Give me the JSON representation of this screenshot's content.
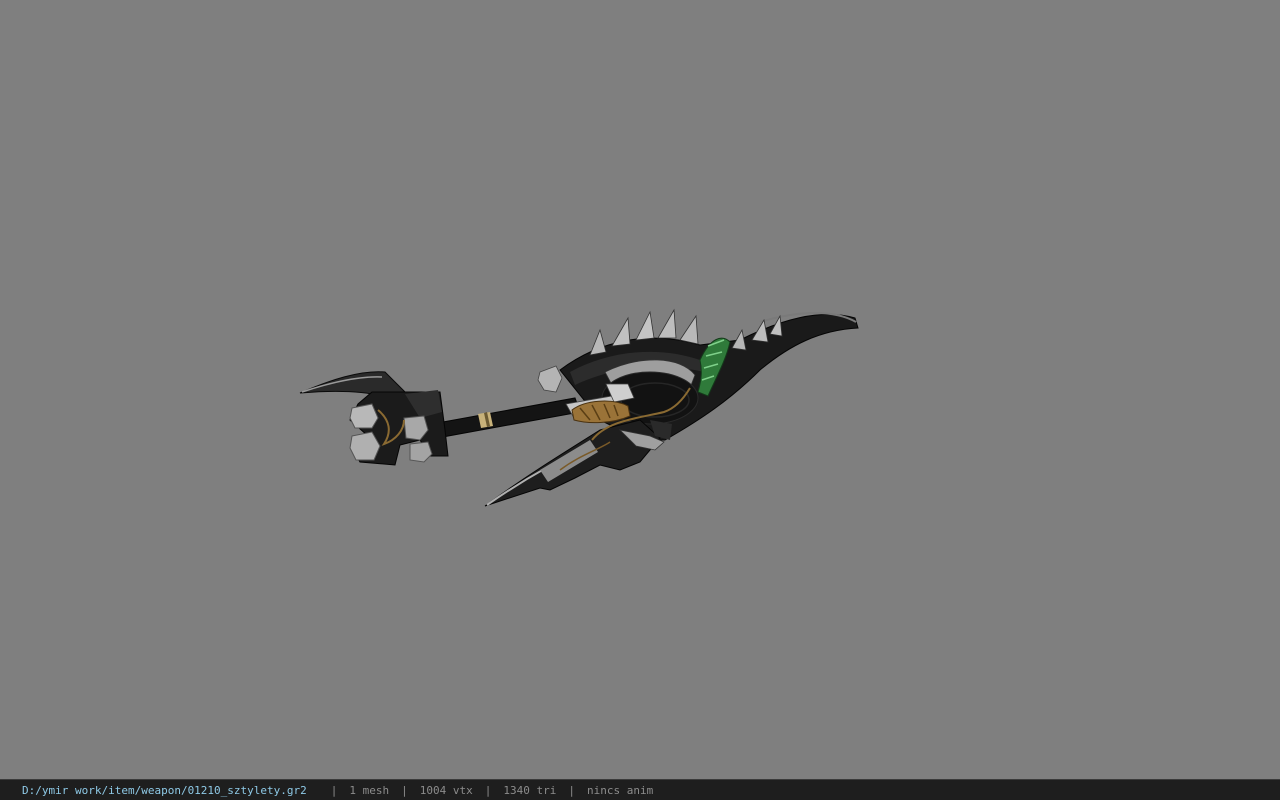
{
  "statusbar": {
    "file_path": "D:/ymir work/item/weapon/01210_sztylety.gr2",
    "separator": "|",
    "mesh_count": "1 mesh",
    "vertex_count": "1004 vtx",
    "triangle_count": "1340 tri",
    "anim_status": "nincs anim",
    "path_color": "#8ec9e6",
    "text_color": "#8c8c8c"
  },
  "viewport": {
    "background_color": "#7f7f7f",
    "model_icon": "dagger-weapon-model"
  }
}
